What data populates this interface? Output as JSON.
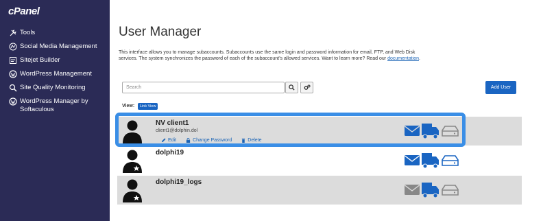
{
  "sidebar": {
    "logo": "cPanel",
    "items": [
      {
        "label": "Tools",
        "icon": "tools-icon"
      },
      {
        "label": "Social Media Management",
        "icon": "social-icon"
      },
      {
        "label": "Sitejet Builder",
        "icon": "sitejet-icon"
      },
      {
        "label": "WordPress Management",
        "icon": "wordpress-icon"
      },
      {
        "label": "Site Quality Monitoring",
        "icon": "magnifier-icon"
      },
      {
        "label": "WordPress Manager by Softaculous",
        "icon": "wordpress-icon"
      }
    ]
  },
  "page": {
    "title": "User Manager",
    "description": "This interface allows you to manage subaccounts. Subaccounts use the same login and password information for email, FTP, and Web Disk services. The system synchronizes the password of each of the subaccount’s allowed services. Want to learn more? Read our",
    "doc_link": "documentation",
    "doc_suffix": "."
  },
  "toolbar": {
    "search_placeholder": "Search",
    "add_user_label": "Add User"
  },
  "view": {
    "label": "View:",
    "mode": "Link View"
  },
  "users": [
    {
      "name": "NV client1",
      "email": "client1@dolphin.dol",
      "actions": [
        "Edit",
        "Change Password",
        "Delete"
      ],
      "services": {
        "email": "enabled",
        "ftp": "enabled",
        "webdisk": "disabled"
      }
    },
    {
      "name": "dolphi19",
      "email": "",
      "services": {
        "email": "enabled",
        "ftp": "enabled",
        "webdisk": "enabled"
      }
    },
    {
      "name": "dolphi19_logs",
      "email": "",
      "services": {
        "email": "disabled",
        "ftp": "enabled",
        "webdisk": "disabled"
      }
    }
  ],
  "colors": {
    "sidebar_bg": "#2b2b56",
    "accent": "#1a65c2",
    "enabled_icon": "#1a65c2",
    "disabled_icon": "#888888",
    "highlight": "#3a8ee6"
  }
}
